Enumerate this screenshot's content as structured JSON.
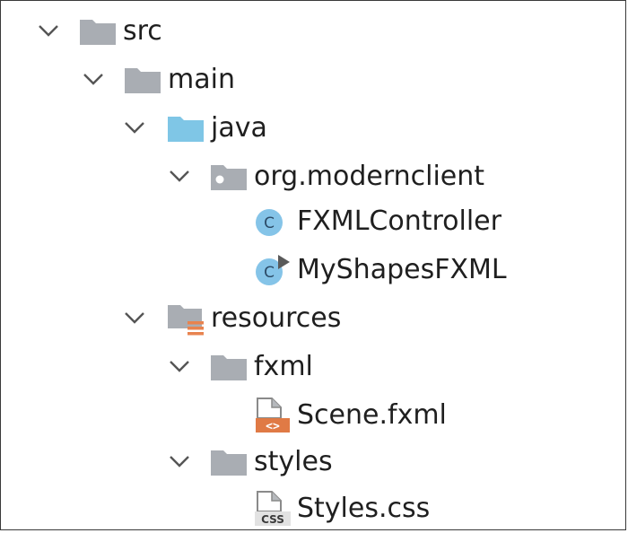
{
  "tree": [
    {
      "label": "src",
      "icon": "folder-icon",
      "expanded": true
    },
    {
      "label": "main",
      "icon": "folder-icon",
      "expanded": true
    },
    {
      "label": "java",
      "icon": "source-folder-icon",
      "expanded": true
    },
    {
      "label": "org.modernclient",
      "icon": "package-icon",
      "expanded": true
    },
    {
      "label": "FXMLController",
      "icon": "java-class-icon"
    },
    {
      "label": "MyShapesFXML",
      "icon": "java-runnable-class-icon"
    },
    {
      "label": "resources",
      "icon": "resources-folder-icon",
      "expanded": true
    },
    {
      "label": "fxml",
      "icon": "folder-icon",
      "expanded": true
    },
    {
      "label": "Scene.fxml",
      "icon": "fxml-file-icon"
    },
    {
      "label": "styles",
      "icon": "folder-icon",
      "expanded": true
    },
    {
      "label": "Styles.css",
      "icon": "css-file-icon"
    }
  ],
  "colors": {
    "folder": "#a9adb3",
    "source_folder": "#7fc6e6",
    "class_icon": "#85c4e8",
    "fxml_badge": "#e07a45",
    "resources_bars": "#e8834f",
    "text": "#1f1f1f",
    "chevron": "#555555"
  },
  "icon_glyphs": {
    "class_letter": "C",
    "fxml_badge": "<>",
    "css_badge": "CSS"
  }
}
